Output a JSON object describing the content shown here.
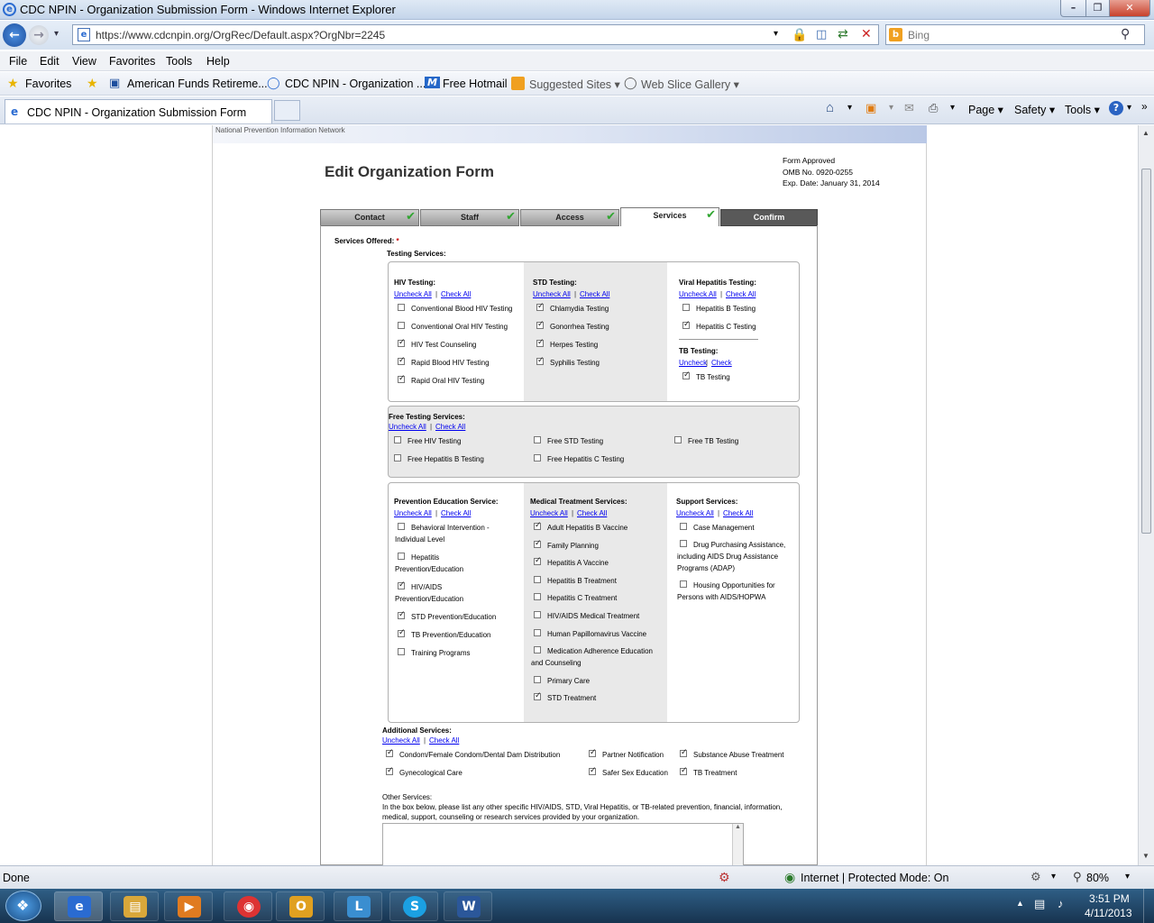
{
  "window": {
    "title": "CDC NPIN - Organization Submission Form - Windows Internet Explorer"
  },
  "address": {
    "url": "https://www.cdcnpin.org/OrgRec/Default.aspx?OrgNbr=2245",
    "search_placeholder": "Bing"
  },
  "menu": [
    "File",
    "Edit",
    "View",
    "Favorites",
    "Tools",
    "Help"
  ],
  "favorites_bar": {
    "favorites": "Favorites",
    "items": [
      "American Funds Retireme...",
      "CDC NPIN - Organization ...",
      "Free Hotmail",
      "Suggested Sites ▾",
      "Web Slice Gallery ▾"
    ]
  },
  "tab": {
    "title": "CDC NPIN - Organization Submission Form"
  },
  "commands": {
    "page": "Page ▾",
    "safety": "Safety ▾",
    "tools": "Tools ▾"
  },
  "page": {
    "banner": "National Prevention Information Network",
    "title": "Edit Organization Form",
    "omb": [
      "Form Approved",
      "OMB No. 0920-0255",
      "Exp. Date: January 31, 2014"
    ],
    "steps": [
      {
        "label": "Contact",
        "done": true
      },
      {
        "label": "Staff",
        "done": true
      },
      {
        "label": "Access",
        "done": true
      },
      {
        "label": "Services",
        "done": true,
        "active": true
      },
      {
        "label": "Confirm",
        "done": false
      }
    ],
    "services_offered": "Services Offered:",
    "required_mark": "*",
    "testing_services": "Testing Services:",
    "uncheck_all": "Uncheck All",
    "check_all": "Check All",
    "uncheck": "Uncheck",
    "check": "Check",
    "hiv": {
      "heading": "HIV Testing:",
      "items": [
        {
          "label": "Conventional Blood HIV Testing",
          "checked": false
        },
        {
          "label": "Conventional Oral HIV Testing",
          "checked": false
        },
        {
          "label": "HIV Test Counseling",
          "checked": true
        },
        {
          "label": "Rapid Blood HIV Testing",
          "checked": true
        },
        {
          "label": "Rapid Oral HIV Testing",
          "checked": true
        }
      ]
    },
    "std": {
      "heading": "STD Testing:",
      "items": [
        {
          "label": "Chlamydia Testing",
          "checked": true
        },
        {
          "label": "Gonorrhea Testing",
          "checked": true
        },
        {
          "label": "Herpes Testing",
          "checked": true
        },
        {
          "label": "Syphilis Testing",
          "checked": true
        }
      ]
    },
    "viral": {
      "heading": "Viral Hepatitis Testing:",
      "items": [
        {
          "label": "Hepatitis B Testing",
          "checked": false
        },
        {
          "label": "Hepatitis C Testing",
          "checked": true
        }
      ]
    },
    "tb": {
      "heading": "TB Testing:",
      "items": [
        {
          "label": "TB Testing",
          "checked": true
        }
      ]
    },
    "free": {
      "heading": "Free Testing Services:",
      "items": [
        {
          "label": "Free HIV Testing",
          "checked": false
        },
        {
          "label": "Free STD Testing",
          "checked": false
        },
        {
          "label": "Free TB Testing",
          "checked": false
        },
        {
          "label": "Free Hepatitis B Testing",
          "checked": false
        },
        {
          "label": "Free Hepatitis C Testing",
          "checked": false
        }
      ]
    },
    "prevention": {
      "heading": "Prevention Education Service:",
      "items": [
        {
          "l1": "Behavioral Intervention -",
          "l2": "Individual Level",
          "checked": false
        },
        {
          "l1": "Hepatitis",
          "l2": "Prevention/Education",
          "checked": false
        },
        {
          "l1": "HIV/AIDS",
          "l2": "Prevention/Education",
          "checked": true
        },
        {
          "l1": "STD Prevention/Education",
          "l2": "",
          "checked": true
        },
        {
          "l1": "TB Prevention/Education",
          "l2": "",
          "checked": true
        },
        {
          "l1": "Training Programs",
          "l2": "",
          "checked": false
        }
      ]
    },
    "medical": {
      "heading": "Medical Treatment Services:",
      "items": [
        {
          "l1": "Adult Hepatitis B Vaccine",
          "l2": "",
          "checked": true
        },
        {
          "l1": "Family Planning",
          "l2": "",
          "checked": true
        },
        {
          "l1": "Hepatitis A Vaccine",
          "l2": "",
          "checked": true
        },
        {
          "l1": "Hepatitis B Treatment",
          "l2": "",
          "checked": false
        },
        {
          "l1": "Hepatitis C Treatment",
          "l2": "",
          "checked": false
        },
        {
          "l1": "HIV/AIDS Medical Treatment",
          "l2": "",
          "checked": false
        },
        {
          "l1": "Human Papillomavirus Vaccine",
          "l2": "",
          "checked": false
        },
        {
          "l1": "Medication Adherence Education",
          "l2": "and Counseling",
          "checked": false
        },
        {
          "l1": "Primary Care",
          "l2": "",
          "checked": false
        },
        {
          "l1": "STD Treatment",
          "l2": "",
          "checked": true
        }
      ]
    },
    "support": {
      "heading": "Support Services:",
      "items": [
        {
          "l1": "Case Management",
          "l2": "",
          "l3": "",
          "checked": false
        },
        {
          "l1": "Drug Purchasing Assistance,",
          "l2": "including AIDS Drug Assistance",
          "l3": "Programs (ADAP)",
          "checked": false
        },
        {
          "l1": "Housing Opportunities for",
          "l2": "Persons with AIDS/HOPWA",
          "l3": "",
          "checked": false
        }
      ]
    },
    "additional": {
      "heading": "Additional Services:",
      "items": [
        {
          "label": "Condom/Female Condom/Dental Dam Distribution",
          "checked": true
        },
        {
          "label": "Partner Notification",
          "checked": true
        },
        {
          "label": "Substance Abuse Treatment",
          "checked": true
        },
        {
          "label": "Gynecological Care",
          "checked": true
        },
        {
          "label": "Safer Sex Education",
          "checked": true
        },
        {
          "label": "TB Treatment",
          "checked": true
        }
      ]
    },
    "other": {
      "heading": "Other Services:",
      "line1": "In the box below, please list any other specific HIV/AIDS, STD, Viral Hepatitis, or TB-related prevention, financial, information,",
      "line2": "medical, support, counseling or research services provided by your organization.",
      "value": ""
    }
  },
  "status": {
    "left": "Done",
    "zone": "Internet | Protected Mode: On",
    "zoom": "80%"
  },
  "taskbar": {
    "time": "3:51 PM",
    "date": "4/11/2013"
  }
}
